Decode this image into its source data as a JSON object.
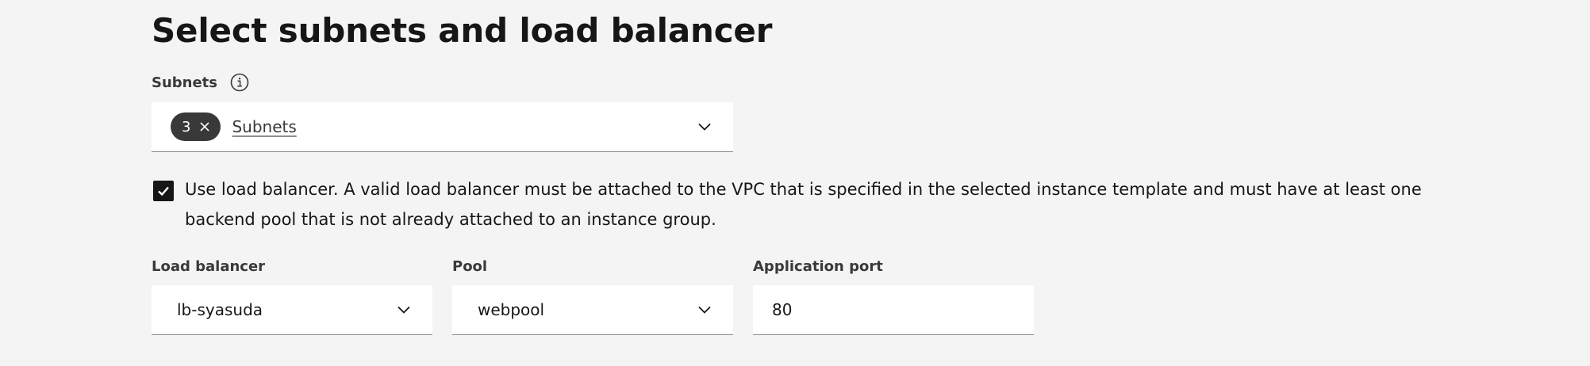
{
  "page": {
    "title": "Select subnets and load balancer"
  },
  "subnets": {
    "label": "Subnets",
    "info_icon": "info-icon",
    "tag_count": "3",
    "tag_close_icon": "close-icon",
    "placeholder": "Subnets",
    "dropdown_icon": "chevron-down-icon"
  },
  "load_balancer_option": {
    "checked": true,
    "label": "Use load balancer. A valid load balancer must be attached to the VPC that is specified in the selected instance template and must have at least one backend pool that is not already attached to an instance group."
  },
  "load_balancer": {
    "label": "Load balancer",
    "selected": "lb-syasuda",
    "dropdown_icon": "chevron-down-icon"
  },
  "pool": {
    "label": "Pool",
    "selected": "webpool",
    "dropdown_icon": "chevron-down-icon"
  },
  "application_port": {
    "label": "Application port",
    "value": "80"
  },
  "colors": {
    "background": "#f4f4f4",
    "field_background": "#ffffff",
    "field_border": "#8d8d8d",
    "text_primary": "#161616",
    "text_secondary": "#393939",
    "tag_background": "#393939",
    "checkbox_fill": "#161616"
  }
}
